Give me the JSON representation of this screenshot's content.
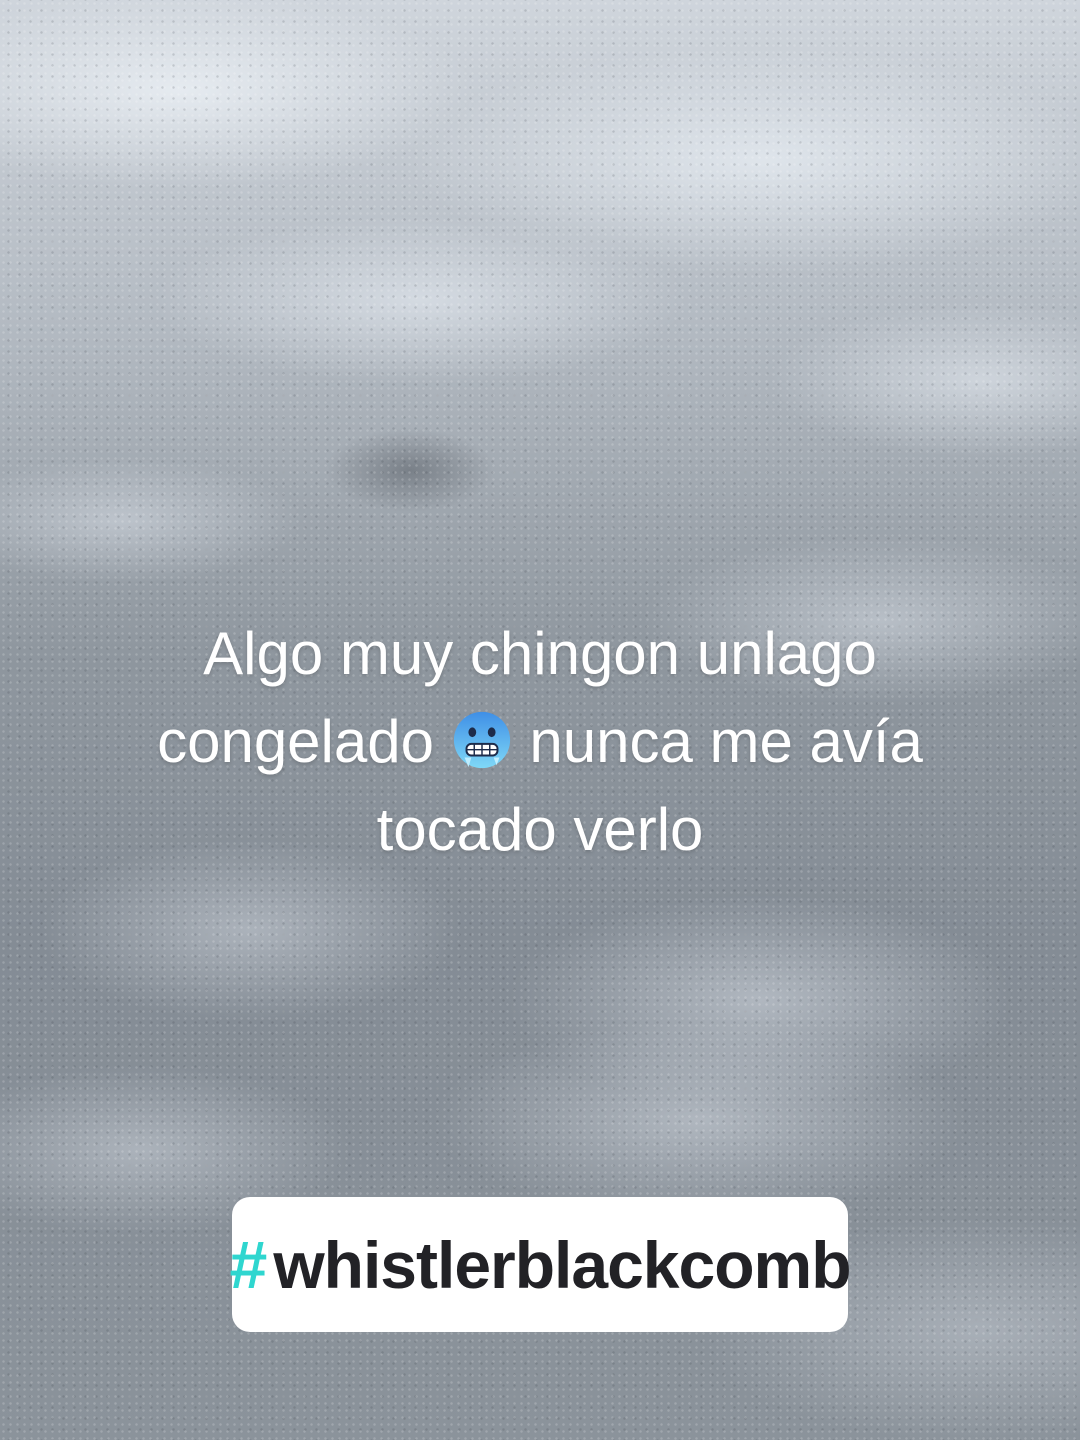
{
  "caption": {
    "text_before_emoji": "Algo muy chingon unlago congelado ",
    "emoji_name": "cold-face-icon",
    "text_after_emoji": " nunca me avía tocado verlo"
  },
  "hashtag": {
    "symbol": "#",
    "text": "whistlerblackcomb",
    "symbol_color": "#2fd6cf",
    "text_color": "#222226"
  }
}
